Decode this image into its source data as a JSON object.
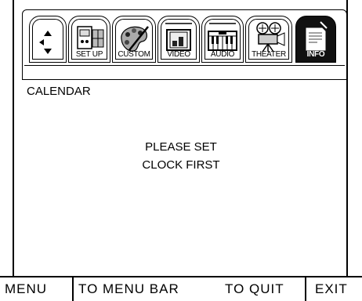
{
  "tabs": [
    {
      "id": "navigate",
      "label": "",
      "icon": "arrows-icon",
      "selected": false
    },
    {
      "id": "setup",
      "label": "SET UP",
      "icon": "wall-outlet-icon",
      "selected": false
    },
    {
      "id": "custom",
      "label": "CUSTOM",
      "icon": "palette-icon",
      "selected": false
    },
    {
      "id": "video",
      "label": "VIDEO",
      "icon": "monitor-icon",
      "selected": false
    },
    {
      "id": "audio",
      "label": "AUDIO",
      "icon": "piano-keys-icon",
      "selected": false
    },
    {
      "id": "theater",
      "label": "THEATER",
      "icon": "film-camera-icon",
      "selected": false
    },
    {
      "id": "info",
      "label": "INFO",
      "icon": "document-icon",
      "selected": true
    }
  ],
  "section_title": "CALENDAR",
  "message": {
    "line1": "PLEASE SET",
    "line2": "CLOCK FIRST"
  },
  "menu_bar": {
    "menu": "MENU",
    "to_menu_bar": "TO MENU BAR",
    "to_quit": "TO QUIT",
    "exit": "EXIT"
  },
  "colors": {
    "background": "#ffffff",
    "foreground": "#000000",
    "selected_tab": "#111111"
  }
}
